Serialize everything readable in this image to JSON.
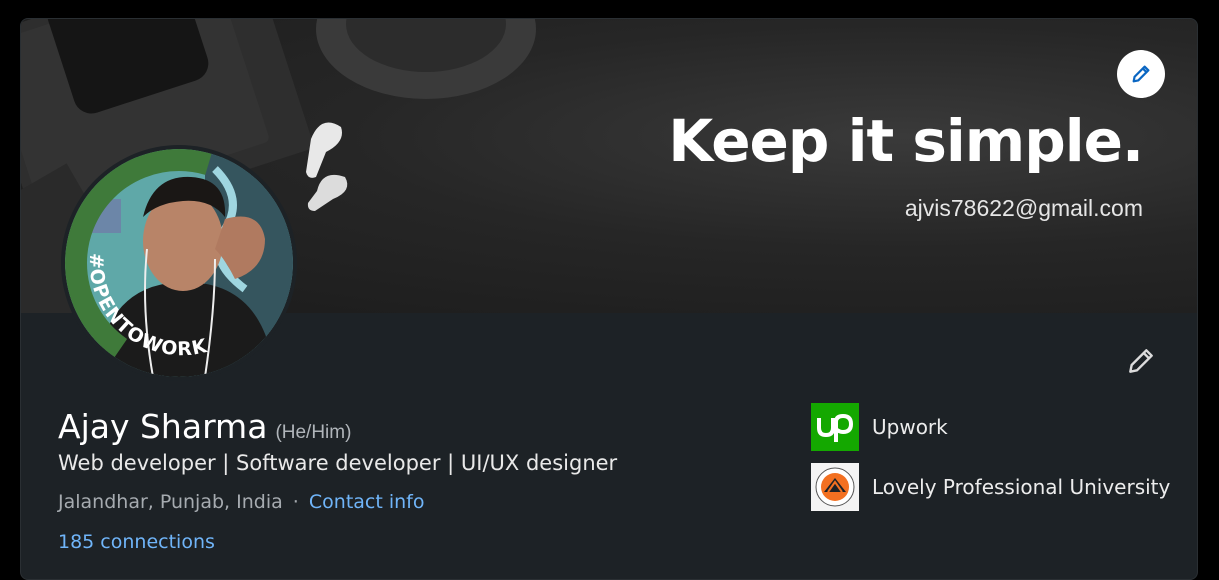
{
  "banner": {
    "headline": "Keep it simple.",
    "email": "ajvis78622@gmail.com",
    "edit_icon": "pencil-icon"
  },
  "profile": {
    "name": "Ajay Sharma",
    "pronouns": "(He/Him)",
    "headline": "Web developer | Software developer | UI/UX designer",
    "location": "Jalandhar, Punjab, India",
    "separator": "·",
    "contact_label": "Contact info",
    "connections": "185 connections",
    "open_to_work_badge": "#OPENTOWORK",
    "edit_icon": "pencil-icon"
  },
  "organizations": [
    {
      "name": "Upwork",
      "logo": "upwork-logo",
      "logo_text": "up",
      "logo_color": "#14a800"
    },
    {
      "name": "Lovely Professional University",
      "logo": "lpu-logo",
      "logo_color": "#f37021"
    }
  ],
  "colors": {
    "card_bg": "#1d2226",
    "link": "#70b5f9",
    "open_to_work_ring": "#3f7a3a"
  }
}
